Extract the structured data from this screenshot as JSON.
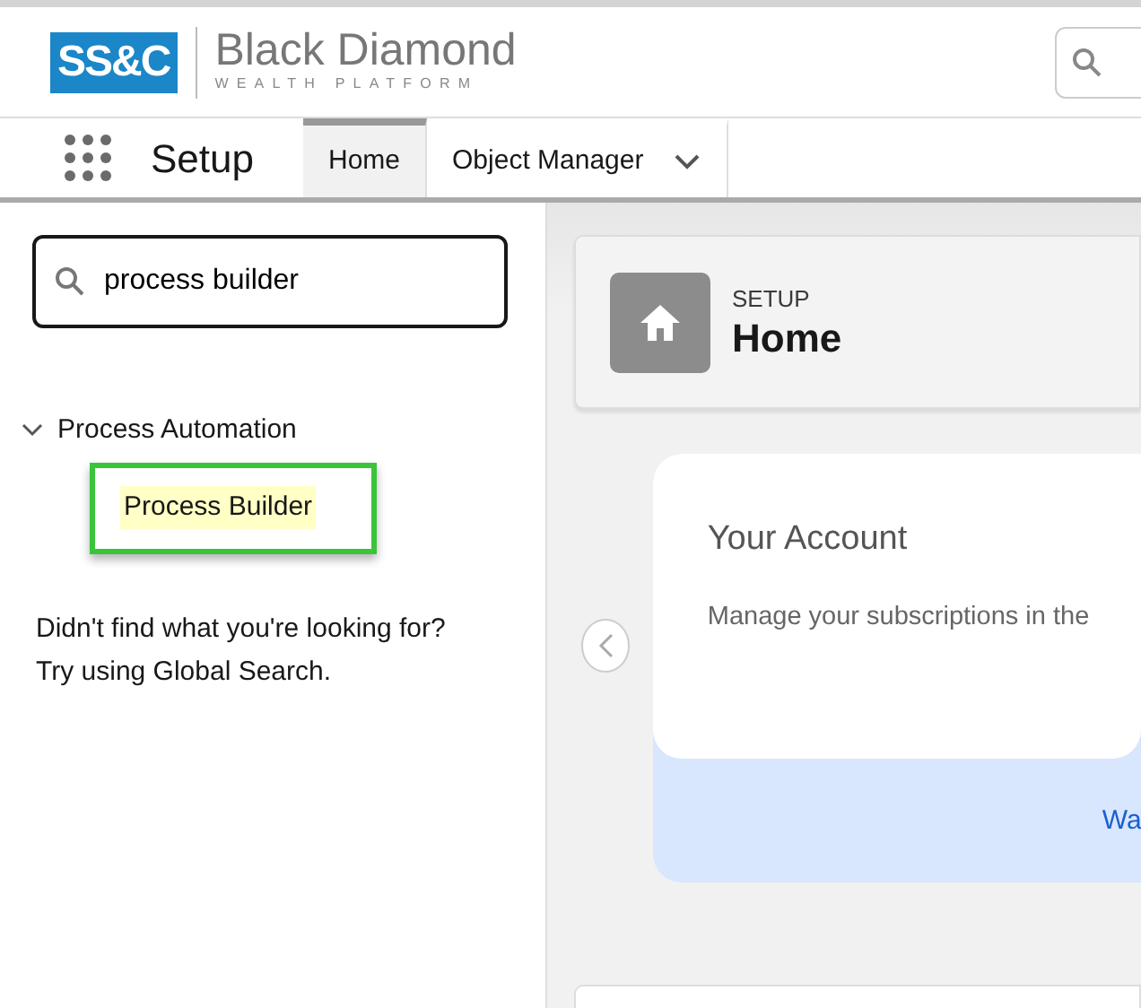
{
  "logo": {
    "mark": "SS&C",
    "name": "Black Diamond",
    "tagline": "WEALTH PLATFORM"
  },
  "app_name": "Setup",
  "tabs": [
    {
      "label": "Home",
      "selected": true,
      "has_menu": false
    },
    {
      "label": "Object Manager",
      "selected": false,
      "has_menu": true
    }
  ],
  "sidebar": {
    "search": {
      "value": "process builder"
    },
    "tree": [
      {
        "label": "Process Automation",
        "expanded": true,
        "children": [
          {
            "label": "Process Builder",
            "highlighted": true,
            "boxed": true
          }
        ]
      }
    ],
    "message": [
      "Didn't find what you're looking for?",
      "Try using Global Search."
    ]
  },
  "page_header": {
    "eyebrow": "SETUP",
    "title": "Home"
  },
  "carousel": {
    "card_title": "Your Account",
    "card_text": "Manage your subscriptions in the",
    "link": "Wa"
  }
}
